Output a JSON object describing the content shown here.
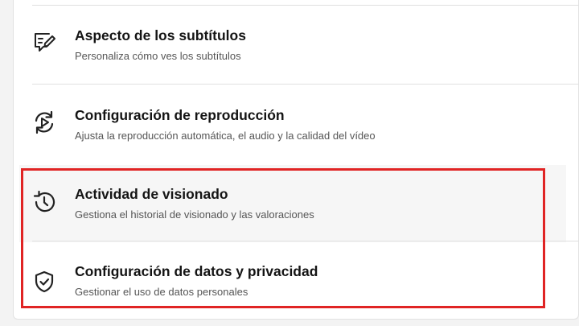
{
  "settings": {
    "items": [
      {
        "title": "Aspecto de los subtítulos",
        "subtitle": "Personaliza cómo ves los subtítulos",
        "icon": "subtitle-edit-icon"
      },
      {
        "title": "Configuración de reproducción",
        "subtitle": "Ajusta la reproducción automática, el audio y la calidad del vídeo",
        "icon": "playback-icon"
      },
      {
        "title": "Actividad de visionado",
        "subtitle": "Gestiona el historial de visionado y las valoraciones",
        "icon": "history-icon"
      },
      {
        "title": "Configuración de datos y privacidad",
        "subtitle": "Gestionar el uso de datos personales",
        "icon": "shield-check-icon"
      }
    ]
  },
  "annotation": {
    "color": "#e02424"
  }
}
